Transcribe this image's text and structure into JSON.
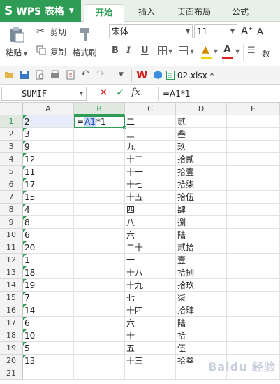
{
  "app": {
    "name": "WPS 表格",
    "logo": "S"
  },
  "tabs": [
    "开始",
    "插入",
    "页面布局",
    "公式"
  ],
  "ribbon": {
    "paste": "粘贴",
    "cut": "剪切",
    "copy": "复制",
    "format_painter": "格式刷",
    "font_name": "宋体",
    "font_size": "11",
    "bold": "B",
    "italic": "I",
    "underline": "U",
    "more_label": "数"
  },
  "file_tab": "02.xlsx *",
  "formula_bar": {
    "name_box": "SUMIF",
    "cancel": "✕",
    "confirm": "✓",
    "fx": "fx",
    "formula": "=A1*1"
  },
  "columns": [
    "A",
    "B",
    "C",
    "D",
    "E"
  ],
  "rows": [
    "1",
    "2",
    "3",
    "4",
    "5",
    "6",
    "7",
    "8",
    "9",
    "10",
    "11",
    "12",
    "13",
    "14",
    "15",
    "16",
    "17",
    "18",
    "19",
    "20",
    "21"
  ],
  "editing_cell": {
    "prefix": "=",
    "ref": "A1",
    "suffix": "*1"
  },
  "col_a": [
    "2",
    "3",
    "9",
    "12",
    "11",
    "17",
    "15",
    "4",
    "8",
    "6",
    "20",
    "1",
    "18",
    "19",
    "7",
    "14",
    "6",
    "10",
    "5",
    "13"
  ],
  "col_c": [
    "二",
    "三",
    "九",
    "十二",
    "十一",
    "十七",
    "十五",
    "四",
    "八",
    "六",
    "二十",
    "一",
    "十八",
    "十九",
    "七",
    "十四",
    "六",
    "十",
    "五",
    "十三"
  ],
  "col_d": [
    "贰",
    "叁",
    "玖",
    "拾贰",
    "拾壹",
    "拾柒",
    "拾伍",
    "肆",
    "捌",
    "陆",
    "贰拾",
    "壹",
    "拾捌",
    "拾玖",
    "柒",
    "拾肆",
    "陆",
    "拾",
    "伍",
    "拾叁"
  ],
  "watermark": "Baidu 经验",
  "colors": {
    "accent": "#2e9c54",
    "ref_highlight": "#c9d8f4"
  }
}
